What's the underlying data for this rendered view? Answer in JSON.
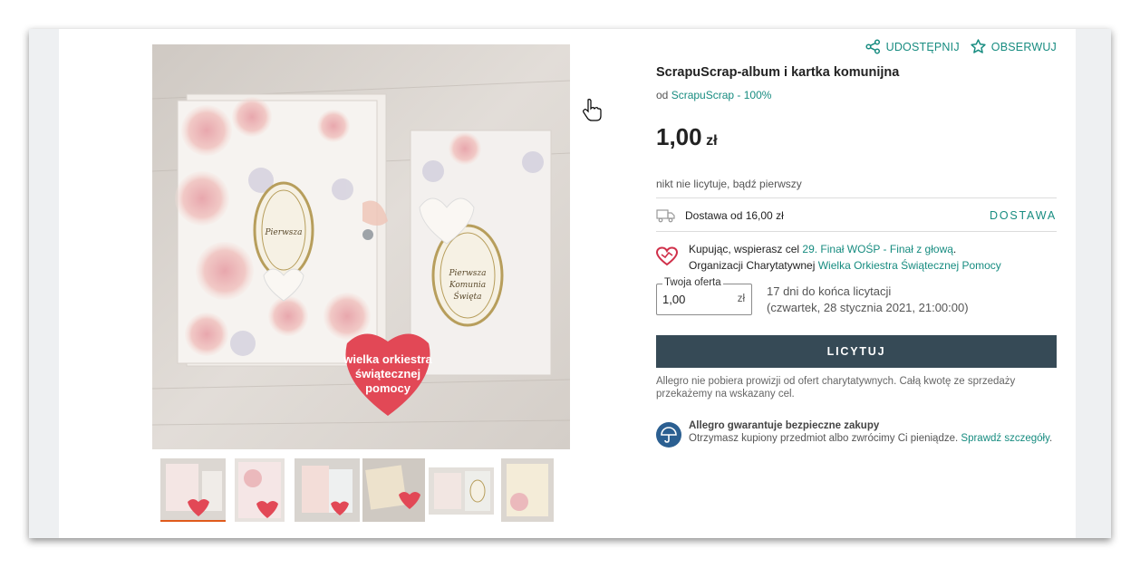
{
  "header": {
    "share_label": "UDOSTĘPNIJ",
    "watch_label": "OBSERWUJ"
  },
  "product": {
    "title": "ScrapuScrap-album i kartka komunijna",
    "seller_prefix": "od",
    "seller_name": "ScrapuScrap - 100%",
    "price_main": "1,00",
    "price_currency": "zł",
    "bid_status": "nikt nie licytuje, bądź pierwszy"
  },
  "photo": {
    "album_heart_text": "wielka orkiestra świątecznej pomocy",
    "label_text": "Pierwsza Komunia Święta",
    "thumbnail_count": 6,
    "active_thumbnail": 1
  },
  "delivery": {
    "text": "Dostawa od 16,00 zł",
    "link": "DOSTAWA"
  },
  "charity": {
    "line1_prefix": "Kupując, wspierasz cel",
    "line1_link": "29. Finał WOŚP - Finał z głową",
    "line1_suffix": ".",
    "line2_prefix": "Organizacji Charytatywnej",
    "line2_link": "Wielka Orkiestra Świątecznej Pomocy"
  },
  "offer": {
    "legend": "Twoja oferta",
    "value": "1,00",
    "currency": "zł",
    "deadline_line1": "17 dni do końca licytacji",
    "deadline_line2": "(czwartek, 28 stycznia 2021, 21:00:00)"
  },
  "bid_button": "LICYTUJ",
  "note": "Allegro nie pobiera prowizji od ofert charytatywnych. Całą kwotę ze sprzedaży przekażemy na wskazany cel.",
  "guarantee": {
    "title": "Allegro gwarantuje bezpieczne zakupy",
    "text": "Otrzymasz kupiony przedmiot albo zwrócimy Ci pieniądze.",
    "link": "Sprawdź szczegóły",
    "suffix": "."
  },
  "colors": {
    "accent": "#178c80",
    "button": "#364a56",
    "active_thumb": "#e05a1c",
    "charity_heart": "#d0304a",
    "guarantee_badge": "#2b5f91"
  }
}
